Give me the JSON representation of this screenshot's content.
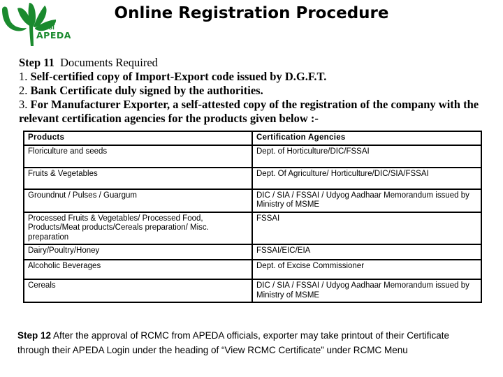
{
  "header": {
    "title": "Online Registration Procedure",
    "logo": {
      "name": "apeda-logo",
      "hindi_text": "एपीडा",
      "english_text": "APEDA",
      "color": "#1a8a2e"
    }
  },
  "step11": {
    "label": "Step 11",
    "heading": "Documents Required",
    "documents": [
      {
        "num": "1.",
        "text": "Self-certified copy of Import-Export code issued by D.G.F.T."
      },
      {
        "num": "2.",
        "text": "Bank Certificate duly signed by the authorities."
      },
      {
        "num": "3.",
        "text": "For Manufacturer Exporter, a self-attested copy of the registration of the company with the relevant certification agencies for the products given below :-"
      }
    ]
  },
  "table": {
    "headers": [
      "Products",
      "Certification Agencies"
    ],
    "rows": [
      {
        "product": "Floriculture and seeds",
        "agency": "Dept. of Horticulture/DIC/FSSAI"
      },
      {
        "product": "Fruits & Vegetables",
        "agency": "Dept. Of Agriculture/ Horticulture/DIC/SIA/FSSAI"
      },
      {
        "product": "Groundnut / Pulses / Guargum",
        "agency": "DIC / SIA / FSSAI / Udyog Aadhaar Memorandum issued by Ministry of MSME"
      },
      {
        "product": "Processed Fruits & Vegetables/ Processed Food, Products/Meat products/Cereals preparation/ Misc. preparation",
        "agency": "FSSAI"
      },
      {
        "product": "Dairy/Poultry/Honey",
        "agency": "FSSAI/EIC/EIA"
      },
      {
        "product": "Alcoholic Beverages",
        "agency": "Dept. of Excise Commissioner"
      },
      {
        "product": "Cereals",
        "agency": "DIC / SIA / FSSAI / Udyog Aadhaar Memorandum issued by Ministry of MSME"
      }
    ]
  },
  "step12": {
    "label": "Step 12",
    "text": " After the approval of RCMC from APEDA officials, exporter may take printout of their Certificate through their APEDA Login under the heading of “View RCMC Certificate” under RCMC Menu"
  }
}
